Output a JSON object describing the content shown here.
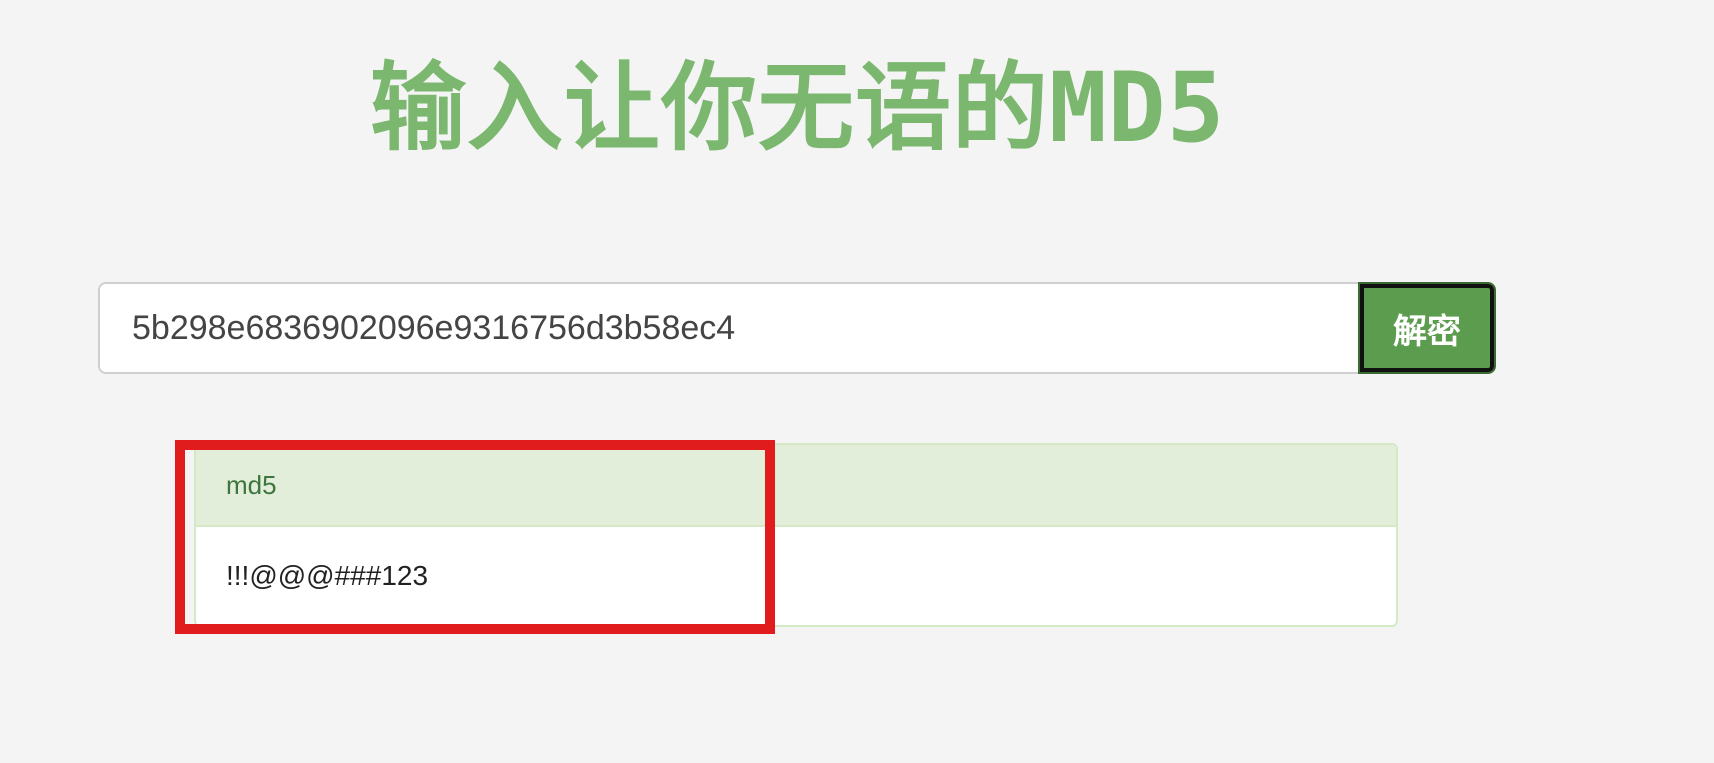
{
  "header": {
    "title": "输入让你无语的MD5"
  },
  "search": {
    "value": "5b298e6836902096e9316756d3b58ec4",
    "button_label": "解密"
  },
  "result": {
    "heading": "md5",
    "value": "!!!@@@###123"
  },
  "colors": {
    "title": "#7bb76e",
    "button": "#5c9c4e",
    "panel_heading_bg": "#e2eed9",
    "highlight": "#e01c1c",
    "background": "#f4f4f4"
  }
}
